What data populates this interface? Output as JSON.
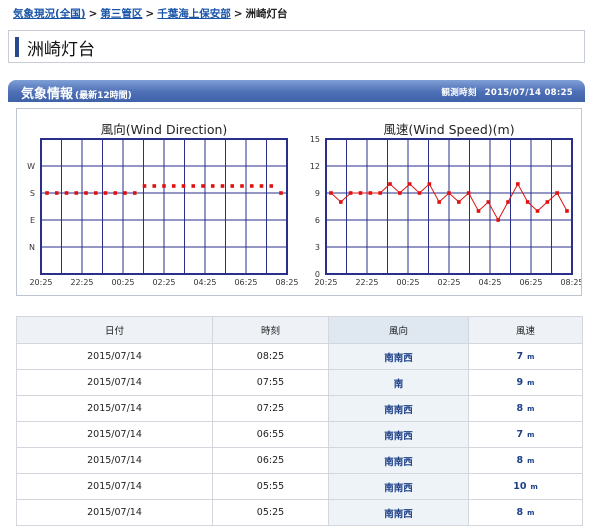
{
  "breadcrumb": {
    "items": [
      "気象現況(全国)",
      "第三管区",
      "千葉海上保安部"
    ],
    "current": "洲崎灯台",
    "separator": ">"
  },
  "page_title": "洲崎灯台",
  "section": {
    "title": "気象情報",
    "subtitle": "(最新12時間)",
    "observed_label": "観測時刻",
    "observed_time": "2015/07/14 08:25"
  },
  "chart_data": [
    {
      "type": "scatter",
      "title": "風向(Wind Direction)",
      "x_tick_labels": [
        "20:25",
        "22:25",
        "00:25",
        "02:25",
        "04:25",
        "06:25",
        "08:25"
      ],
      "y_tick_labels": [
        "N",
        "E",
        "S",
        "W"
      ],
      "y_categories": [
        "N",
        "E",
        "S",
        "W"
      ],
      "series": [
        {
          "values": [
            "S",
            "S",
            "S",
            "S",
            "S",
            "S",
            "S",
            "S",
            "S",
            "S",
            "S",
            "S",
            "S",
            "S",
            "S",
            "S",
            "S",
            "S",
            "S",
            "S",
            "S",
            "S",
            "S",
            "S",
            "S"
          ],
          "offsets": [
            0,
            0,
            0,
            0,
            0,
            0,
            0,
            0,
            0,
            0,
            1,
            1,
            1,
            1,
            1,
            1,
            1,
            1,
            1,
            1,
            1,
            1,
            1,
            1,
            0
          ]
        }
      ],
      "color": "#e01010",
      "grid": true
    },
    {
      "type": "line",
      "title": "風速(Wind Speed)(m)",
      "x_tick_labels": [
        "20:25",
        "22:25",
        "00:25",
        "02:25",
        "04:25",
        "06:25",
        "08:25"
      ],
      "y_tick_labels": [
        "0",
        "3",
        "6",
        "9",
        "12",
        "15"
      ],
      "ylim": [
        0,
        15
      ],
      "series": [
        {
          "values": [
            9,
            8,
            9,
            9,
            9,
            9,
            10,
            9,
            10,
            9,
            10,
            8,
            9,
            8,
            9,
            7,
            8,
            6,
            8,
            10,
            8,
            7,
            8,
            9,
            7
          ]
        }
      ],
      "color": "#e01010",
      "grid": true
    }
  ],
  "table": {
    "headers": [
      "日付",
      "時刻",
      "風向",
      "風速"
    ],
    "unit": "m",
    "rows": [
      [
        "2015/07/14",
        "08:25",
        "南南西",
        "7"
      ],
      [
        "2015/07/14",
        "07:55",
        "南",
        "9"
      ],
      [
        "2015/07/14",
        "07:25",
        "南南西",
        "8"
      ],
      [
        "2015/07/14",
        "06:55",
        "南南西",
        "7"
      ],
      [
        "2015/07/14",
        "06:25",
        "南南西",
        "8"
      ],
      [
        "2015/07/14",
        "05:55",
        "南南西",
        "10"
      ],
      [
        "2015/07/14",
        "05:25",
        "南南西",
        "8"
      ]
    ]
  },
  "colors": {
    "header_blue": "#3f62a8",
    "plot_line": "#2a2f8c",
    "series_red": "#e01010"
  }
}
